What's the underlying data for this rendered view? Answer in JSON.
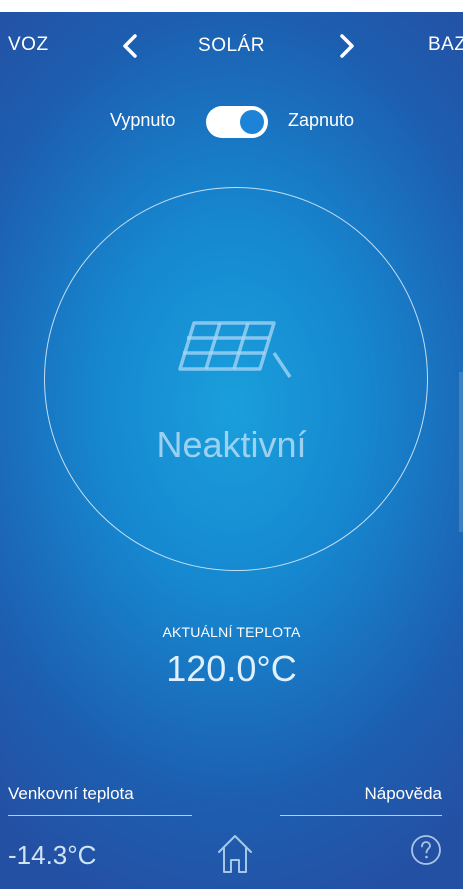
{
  "nav": {
    "prev_label": "VOZ",
    "current_label": "SOLÁR",
    "next_label": "BAZ",
    "prev_icon": "chevron-left-icon",
    "next_icon": "chevron-right-icon"
  },
  "power_toggle": {
    "off_label": "Vypnuto",
    "on_label": "Zapnuto",
    "state": "on"
  },
  "status": {
    "icon": "solar-panel-icon",
    "text": "Neaktivní"
  },
  "current_temperature": {
    "label": "AKTUÁLNÍ TEPLOTA",
    "value": "120.0°C"
  },
  "footer": {
    "outdoor_label": "Venkovní teplota",
    "outdoor_value": "-14.3°C",
    "help_label": "Nápověda",
    "home_icon": "home-icon",
    "help_icon": "question-circle-icon"
  },
  "colors": {
    "background_center": "#1a9fdc",
    "background_edge": "#2450a4",
    "toggle_knob": "#1c83d6",
    "status_text": "#c8e4f8"
  }
}
